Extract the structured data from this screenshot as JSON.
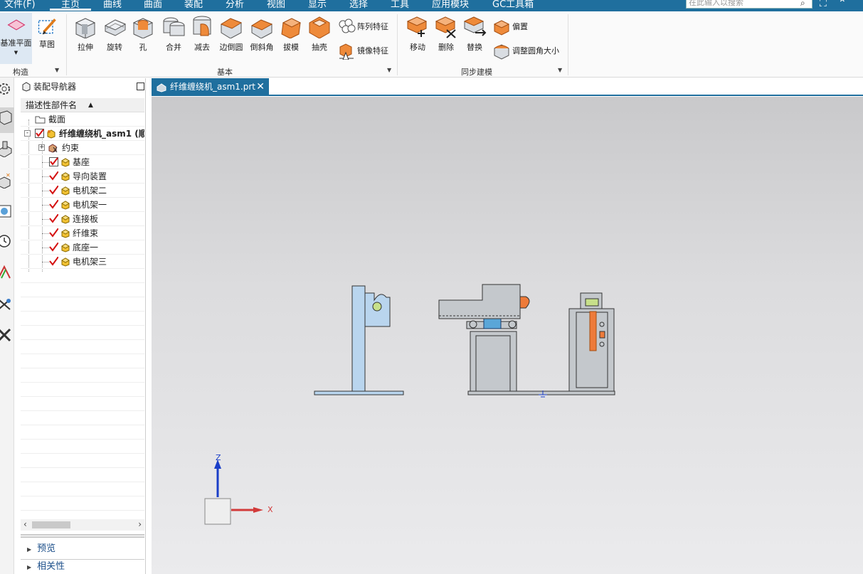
{
  "menubar": {
    "items": [
      "文件(F)",
      "主页",
      "曲线",
      "曲面",
      "装配",
      "分析",
      "视图",
      "显示",
      "选择",
      "工具",
      "应用模块",
      "GC工具箱"
    ],
    "active": "主页",
    "search_placeholder": "在此输入以搜索"
  },
  "ribbon": {
    "construct": {
      "datum_plane": "基准平面",
      "sketch": "草图",
      "group_label": "构造"
    },
    "basic": {
      "extrude": "拉伸",
      "revolve": "旋转",
      "hole": "孔",
      "unite": "合并",
      "subtract": "减去",
      "edge_blend": "边倒圆",
      "chamfer": "倒斜角",
      "draft": "拔模",
      "shell": "抽壳",
      "pattern_feature": "阵列特征",
      "mirror_feature": "镜像特征",
      "group_label": "基本"
    },
    "sync": {
      "move": "移动",
      "delete": "删除",
      "replace": "替换",
      "offset": "偏置",
      "resize_blend": "调整圆角大小",
      "group_label": "同步建模"
    }
  },
  "navigator": {
    "title": "装配导航器",
    "column_header": "描述性部件名",
    "sections_node": "截面",
    "root": "纤维缠绕机_asm1 (顺",
    "constraints": "约束",
    "parts": [
      "基座",
      "导向装置",
      "电机架二",
      "电机架一",
      "连接板",
      "纤维束",
      "底座一",
      "电机架三"
    ],
    "bottom_sections": [
      "预览",
      "相关性"
    ]
  },
  "document": {
    "tab_title": "纤维缠绕机_asm1.prt"
  },
  "viewport": {
    "axis_z": "Z",
    "axis_x": "X",
    "colors": {
      "part_blue": "#b9d5ee",
      "part_gray": "#c4c8cc",
      "orange": "#ee7b3a",
      "triad_blue": "#1a3ec8",
      "triad_red": "#d23a3a"
    }
  }
}
